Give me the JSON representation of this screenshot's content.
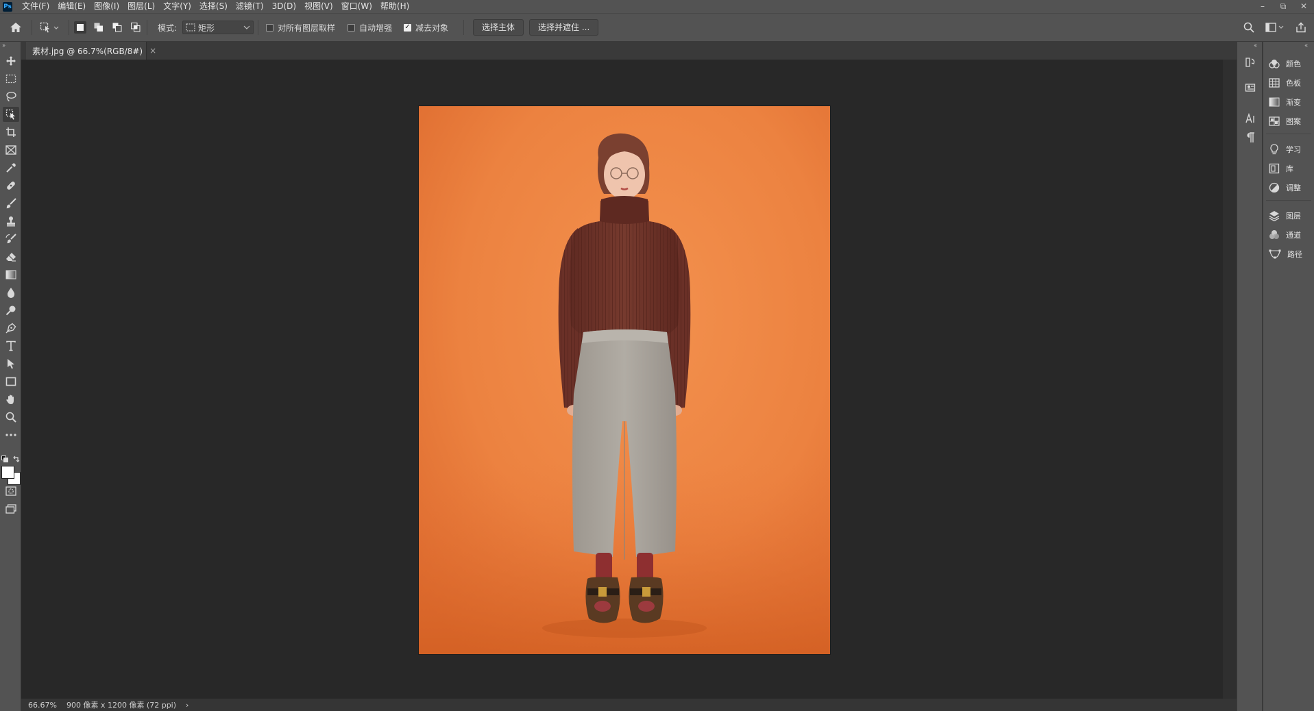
{
  "app": {
    "logo": "Ps"
  },
  "menu": [
    "文件(F)",
    "编辑(E)",
    "图像(I)",
    "图层(L)",
    "文字(Y)",
    "选择(S)",
    "滤镜(T)",
    "3D(D)",
    "视图(V)",
    "窗口(W)",
    "帮助(H)"
  ],
  "window_controls": {
    "minimize": "–",
    "restore": "⧉",
    "close": "✕"
  },
  "options": {
    "mode_label": "模式:",
    "mode_value": "矩形",
    "sample_all_layers": {
      "label": "对所有图层取样",
      "checked": false
    },
    "auto_enhance": {
      "label": "自动增强",
      "checked": false
    },
    "subtract_object": {
      "label": "减去对象",
      "checked": true
    },
    "select_subject": "选择主体",
    "select_and_mask": "选择并遮住 ..."
  },
  "document": {
    "tab_title": "素材.jpg @ 66.7%(RGB/8#)",
    "close_glyph": "×",
    "zoom": "66.67%",
    "doc_info": "900 像素 x 1200 像素 (72 ppi)",
    "status_arrow": "›"
  },
  "toolbar": {
    "tools": [
      "move-tool",
      "rectangular-marquee-tool",
      "lasso-tool",
      "object-selection-tool",
      "crop-tool",
      "frame-tool",
      "eyedropper-tool",
      "healing-brush-tool",
      "brush-tool",
      "clone-stamp-tool",
      "history-brush-tool",
      "eraser-tool",
      "gradient-tool",
      "blur-tool",
      "dodge-tool",
      "pen-tool",
      "type-tool",
      "path-selection-tool",
      "rectangle-tool",
      "hand-tool",
      "zoom-tool",
      "edit-toolbar"
    ],
    "active_tool": "object-selection-tool",
    "foreground_color": "#ffffff",
    "background_color": "#ffffff"
  },
  "panels": [
    {
      "icon": "color-icon",
      "label": "颜色"
    },
    {
      "icon": "swatches-icon",
      "label": "色板"
    },
    {
      "icon": "gradients-icon",
      "label": "渐变"
    },
    {
      "icon": "patterns-icon",
      "label": "图案"
    },
    {
      "icon": "learn-icon",
      "label": "学习"
    },
    {
      "icon": "libraries-icon",
      "label": "库"
    },
    {
      "icon": "adjustments-icon",
      "label": "调整"
    },
    {
      "icon": "layers-icon",
      "label": "图层"
    },
    {
      "icon": "channels-icon",
      "label": "通道"
    },
    {
      "icon": "paths-icon",
      "label": "路径"
    }
  ],
  "colors": {
    "ui_bg": "#535353",
    "canvas_bg": "#282828",
    "photo_background": "#ef8444",
    "sweater": "#6f3329",
    "pants": "#a8a39c"
  }
}
